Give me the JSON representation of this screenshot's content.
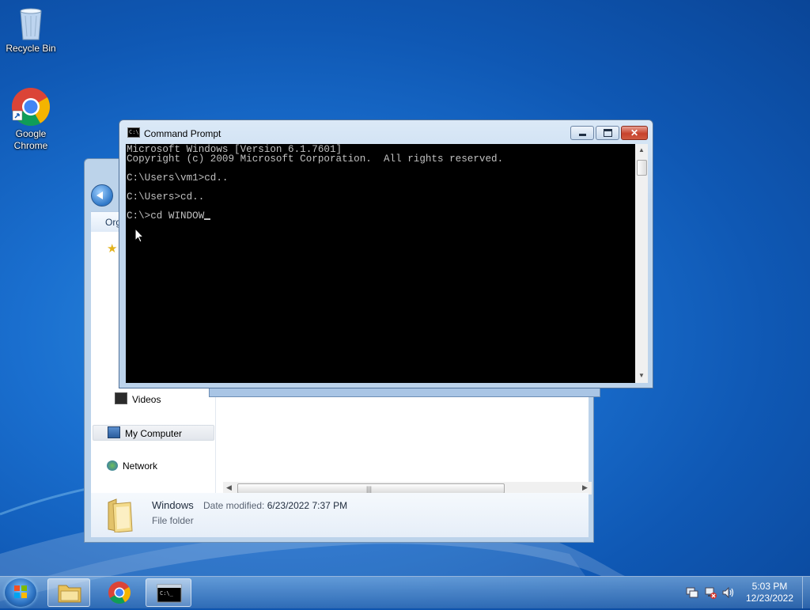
{
  "desktop": {
    "icons": [
      {
        "label": "Recycle Bin"
      },
      {
        "label": "Google Chrome"
      }
    ]
  },
  "explorer": {
    "toolbar_label": "Org",
    "nav": {
      "videos": "Videos",
      "my_computer": "My Computer",
      "network": "Network"
    },
    "details": {
      "name": "Windows",
      "modified_label": "Date modified:",
      "modified_value": "6/23/2022 7:37 PM",
      "type": "File folder"
    }
  },
  "cmd": {
    "title": "Command Prompt",
    "lines": [
      "Microsoft Windows [Version 6.1.7601]",
      "Copyright (c) 2009 Microsoft Corporation.  All rights reserved.",
      "",
      "C:\\Users\\vm1>cd..",
      "",
      "C:\\Users>cd..",
      "",
      "C:\\>cd WINDOW"
    ]
  },
  "taskbar": {
    "clock_time": "5:03 PM",
    "clock_date": "12/23/2022"
  },
  "colors": {
    "console_bg": "#000000",
    "console_text": "#c0c0c0",
    "close_button": "#c7432d"
  }
}
